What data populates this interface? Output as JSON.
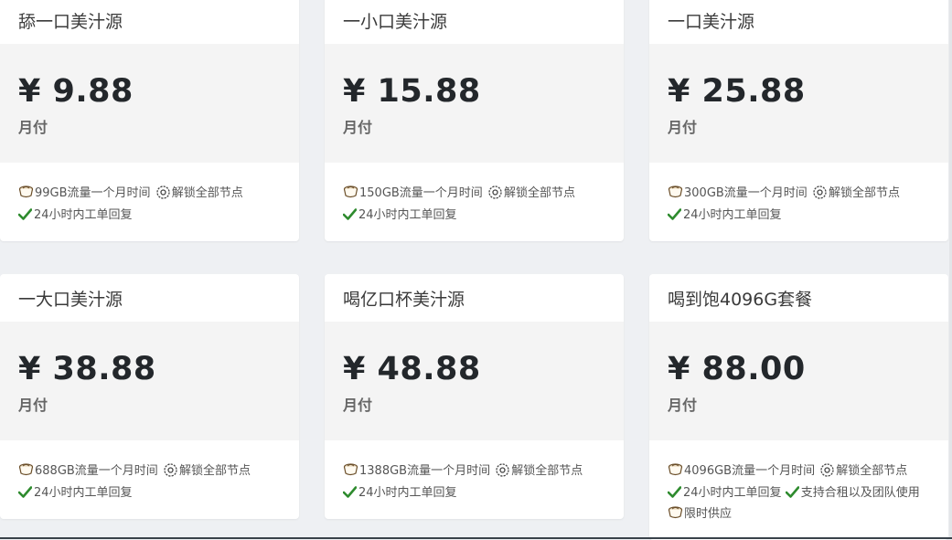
{
  "plans": [
    {
      "name": "舔一口美汁源",
      "price": "¥ 9.88",
      "period": "月付",
      "features": [
        {
          "icon": "tea-icon",
          "text": "99GB流量一个月时间"
        },
        {
          "icon": "gear-icon",
          "text": "解锁全部节点"
        },
        {
          "icon": "check-icon",
          "text": "24小时内工单回复"
        }
      ]
    },
    {
      "name": "一小口美汁源",
      "price": "¥ 15.88",
      "period": "月付",
      "features": [
        {
          "icon": "tea-icon",
          "text": "150GB流量一个月时间"
        },
        {
          "icon": "gear-icon",
          "text": "解锁全部节点"
        },
        {
          "icon": "check-icon",
          "text": "24小时内工单回复"
        }
      ]
    },
    {
      "name": "一口美汁源",
      "price": "¥ 25.88",
      "period": "月付",
      "features": [
        {
          "icon": "tea-icon",
          "text": "300GB流量一个月时间"
        },
        {
          "icon": "gear-icon",
          "text": "解锁全部节点"
        },
        {
          "icon": "check-icon",
          "text": "24小时内工单回复"
        }
      ]
    },
    {
      "name": "一大口美汁源",
      "price": "¥ 38.88",
      "period": "月付",
      "features": [
        {
          "icon": "tea-icon",
          "text": "688GB流量一个月时间"
        },
        {
          "icon": "gear-icon",
          "text": "解锁全部节点"
        },
        {
          "icon": "check-icon",
          "text": "24小时内工单回复"
        }
      ]
    },
    {
      "name": "喝亿口杯美汁源",
      "price": "¥ 48.88",
      "period": "月付",
      "features": [
        {
          "icon": "tea-icon",
          "text": "1388GB流量一个月时间"
        },
        {
          "icon": "gear-icon",
          "text": "解锁全部节点"
        },
        {
          "icon": "check-icon",
          "text": "24小时内工单回复"
        }
      ]
    },
    {
      "name": "喝到饱4096G套餐",
      "price": "¥ 88.00",
      "period": "月付",
      "features": [
        {
          "icon": "tea-icon",
          "text": "4096GB流量一个月时间"
        },
        {
          "icon": "gear-icon",
          "text": "解锁全部节点"
        },
        {
          "icon": "check-icon",
          "text": "24小时内工单回复"
        },
        {
          "icon": "check-icon",
          "text": "支持合租以及团队使用"
        },
        {
          "icon": "tea-icon",
          "text": "限时供应"
        }
      ]
    }
  ],
  "colors": {
    "check": "#2e8b2e",
    "price": "#23272b",
    "page_bg": "#eef0f3"
  }
}
